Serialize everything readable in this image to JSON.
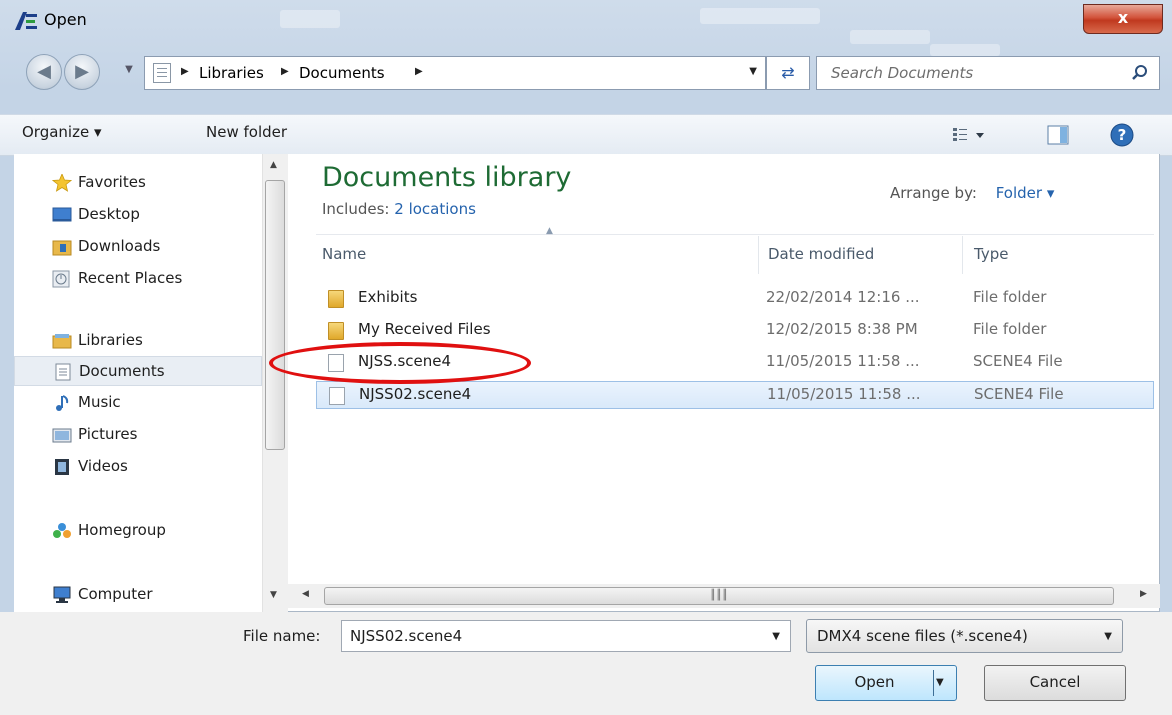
{
  "window": {
    "title": "Open",
    "close_glyph": "x"
  },
  "address_bar": {
    "crumbs": [
      "Libraries",
      "Documents"
    ],
    "search_placeholder": "Search Documents"
  },
  "toolbar": {
    "organize": "Organize ▾",
    "new_folder": "New folder"
  },
  "nav_pane": {
    "favorites": "Favorites",
    "desktop": "Desktop",
    "downloads": "Downloads",
    "recent_places": "Recent Places",
    "libraries": "Libraries",
    "documents": "Documents",
    "music": "Music",
    "pictures": "Pictures",
    "videos": "Videos",
    "homegroup": "Homegroup",
    "computer": "Computer"
  },
  "library": {
    "title": "Documents library",
    "includes_label": "Includes:",
    "includes_link": "2 locations",
    "arrange_label": "Arrange by:",
    "arrange_value": "Folder ▾"
  },
  "columns": {
    "name": "Name",
    "date": "Date modified",
    "type": "Type"
  },
  "files": [
    {
      "name": "Exhibits",
      "date": "22/02/2014 12:16 ...",
      "type": "File folder",
      "icon": "folder-icon"
    },
    {
      "name": "My Received Files",
      "date": "12/02/2015 8:38 PM",
      "type": "File folder",
      "icon": "folder-icon"
    },
    {
      "name": "NJSS.scene4",
      "date": "11/05/2015 11:58 ...",
      "type": "SCENE4 File",
      "icon": "file-icon"
    },
    {
      "name": "NJSS02.scene4",
      "date": "11/05/2015 11:58 ...",
      "type": "SCENE4 File",
      "icon": "file-icon",
      "selected": true
    }
  ],
  "footer": {
    "file_name_label": "File name:",
    "file_name_value": "NJSS02.scene4",
    "file_type": "DMX4 scene files (*.scene4)",
    "open_label": "Open",
    "cancel_label": "Cancel"
  },
  "colors": {
    "annotation": "#e01010",
    "library_title": "#1e6b34",
    "link": "#2563ad"
  }
}
